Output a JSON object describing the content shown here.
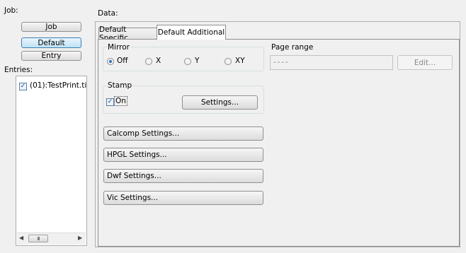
{
  "job": {
    "label": "Job:",
    "buttons": [
      {
        "label": "Job",
        "active": false
      },
      {
        "label": "Default",
        "active": true
      },
      {
        "label": "Entry",
        "active": false
      }
    ]
  },
  "entries": {
    "label": "Entries:",
    "items": [
      {
        "label": "(01):TestPrint.ti",
        "checked": true
      }
    ],
    "scroll_thumb": "III"
  },
  "data": {
    "label": "Data:",
    "tabs": [
      {
        "label": "Default Specific",
        "active": false
      },
      {
        "label": "Default Additional",
        "active": true
      }
    ]
  },
  "mirror": {
    "label": "Mirror",
    "options": [
      {
        "label": "Off",
        "selected": true
      },
      {
        "label": "X",
        "selected": false
      },
      {
        "label": "Y",
        "selected": false
      },
      {
        "label": "XY",
        "selected": false
      }
    ]
  },
  "page_range": {
    "label": "Page range",
    "value": "----",
    "edit_label": "Edit..."
  },
  "stamp": {
    "label": "Stamp",
    "checkbox_label": "On",
    "checked": true,
    "settings_label": "Settings..."
  },
  "settings_buttons": [
    "Calcomp Settings...",
    "HPGL Settings...",
    "Dwf Settings...",
    "Vic Settings..."
  ],
  "colors": {
    "accent": "#2a6fb6",
    "active_button": "#bfe2f6"
  }
}
